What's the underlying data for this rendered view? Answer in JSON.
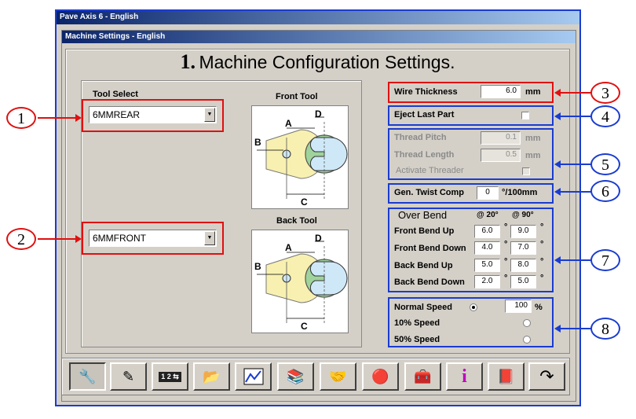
{
  "window": {
    "outer_title": "Pave Axis 6 - English",
    "inner_title": "Machine Settings - English"
  },
  "heading": {
    "number": "1.",
    "text": "Machine Configuration Settings."
  },
  "tool_select": {
    "label": "Tool Select",
    "front_value": "6MMREAR",
    "back_value": "6MMFRONT",
    "front_caption": "Front Tool",
    "back_caption": "Back Tool"
  },
  "diagram": {
    "a": "A",
    "b": "B",
    "c": "C",
    "d": "D"
  },
  "wire": {
    "label": "Wire Thickness",
    "value": "6.0",
    "unit": "mm"
  },
  "eject": {
    "label": "Eject Last Part"
  },
  "thread": {
    "pitch_label": "Thread Pitch",
    "pitch_value": "0.1",
    "pitch_unit": "mm",
    "length_label": "Thread Length",
    "length_value": "0.5",
    "length_unit": "mm",
    "activate_label": "Activate Threader"
  },
  "twist": {
    "label": "Gen. Twist Comp",
    "value": "0",
    "unit": "°/100mm"
  },
  "overbend": {
    "title": "Over Bend",
    "col1": "@ 20°",
    "col2": "@ 90°",
    "deg": "°",
    "rows": [
      {
        "label": "Front Bend Up",
        "v20": "6.0",
        "v90": "9.0"
      },
      {
        "label": "Front Bend Down",
        "v20": "4.0",
        "v90": "7.0"
      },
      {
        "label": "Back Bend Up",
        "v20": "5.0",
        "v90": "8.0"
      },
      {
        "label": "Back Bend Down",
        "v20": "2.0",
        "v90": "5.0"
      }
    ]
  },
  "speed": {
    "normal_label": "Normal Speed",
    "normal_value": "100",
    "unit": "%",
    "s10_label": "10% Speed",
    "s50_label": "50% Speed"
  },
  "callouts": [
    "1",
    "2",
    "3",
    "4",
    "5",
    "6",
    "7",
    "8"
  ],
  "colors": {
    "red": "#e01010",
    "blue": "#1a3ccf",
    "face": "#d4d0c8"
  }
}
